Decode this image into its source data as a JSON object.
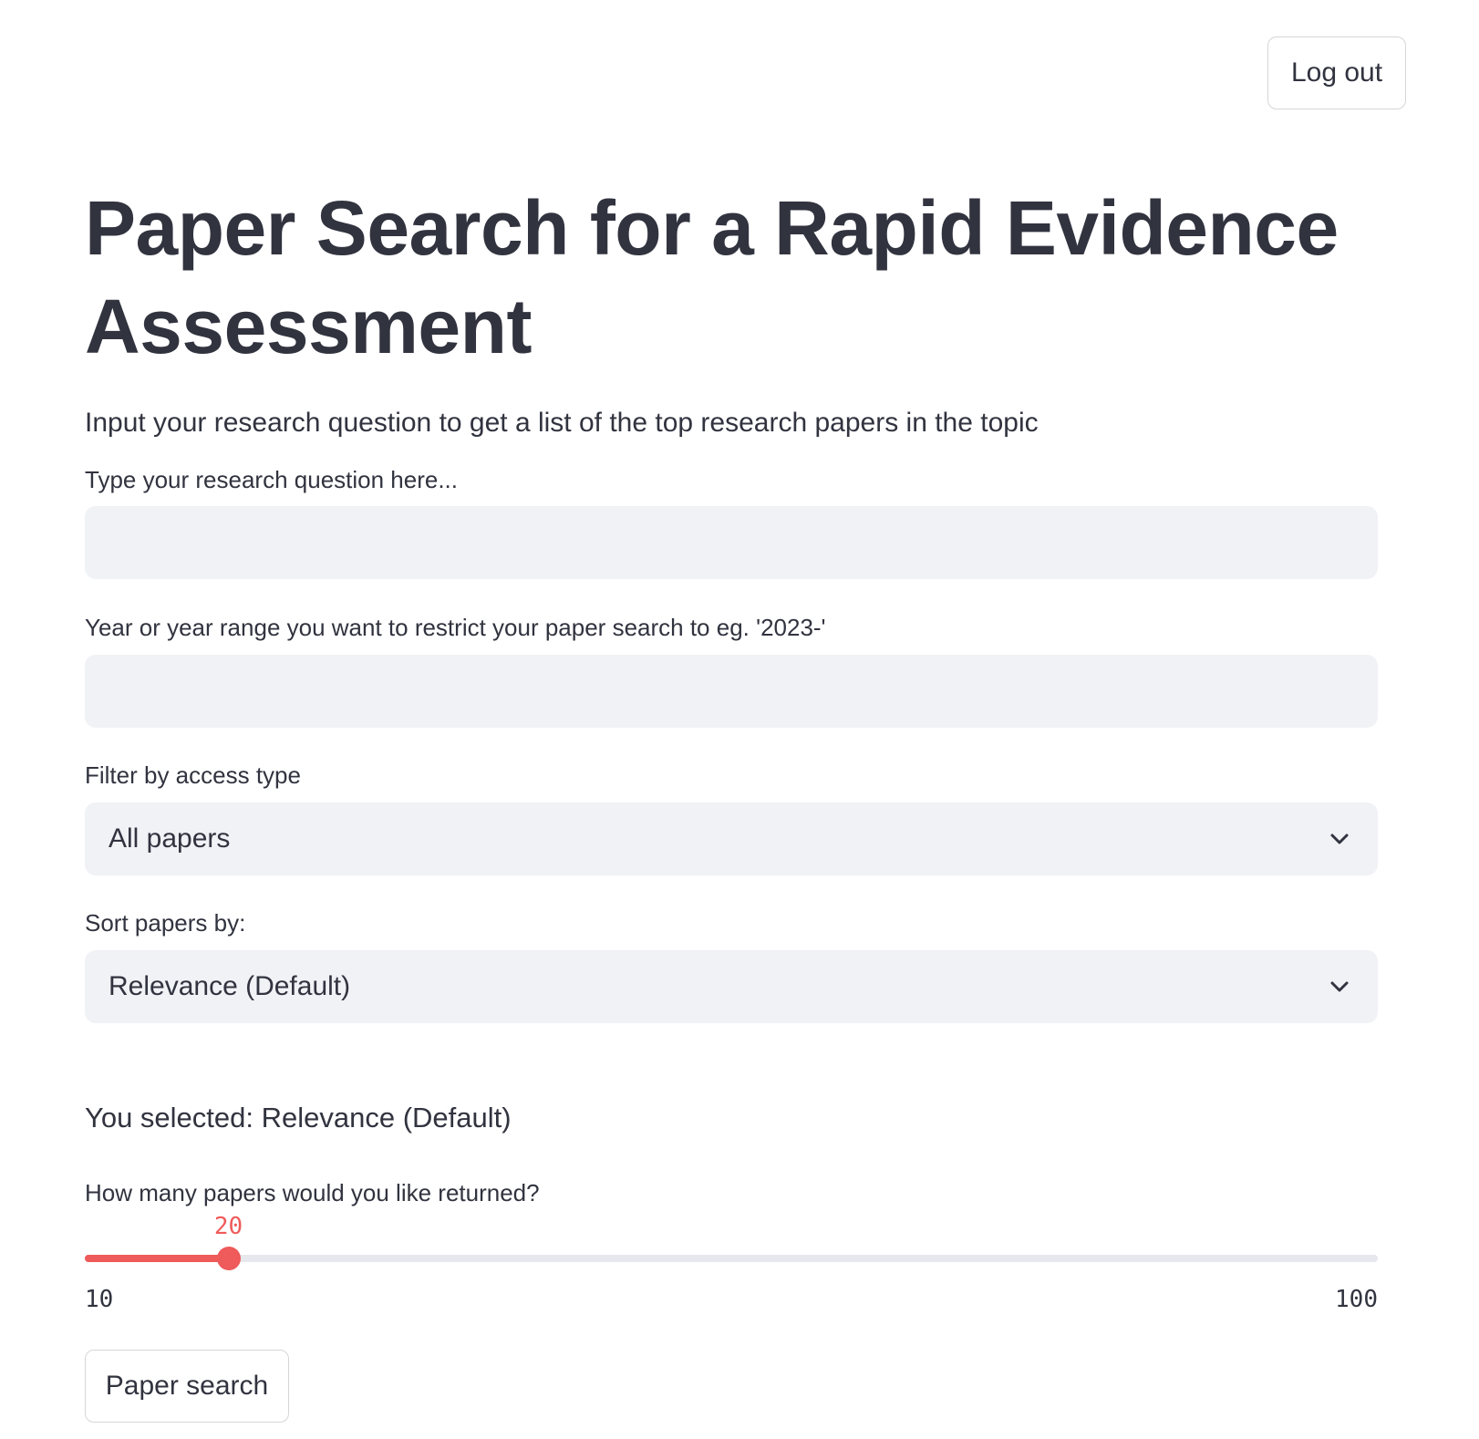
{
  "header": {
    "logout_label": "Log out"
  },
  "main": {
    "title": "Paper Search for a Rapid Evidence Assessment",
    "subtitle": "Input your research question to get a list of the top research papers in the topic"
  },
  "question_field": {
    "label": "Type your research question here...",
    "value": "",
    "placeholder": ""
  },
  "year_field": {
    "label": "Year or year range you want to restrict your paper search to eg. '2023-'",
    "value": "",
    "placeholder": ""
  },
  "access_filter": {
    "label": "Filter by access type",
    "selected": "All papers",
    "icon": "chevron-down-icon"
  },
  "sort_select": {
    "label": "Sort papers by:",
    "selected": "Relevance (Default)",
    "icon": "chevron-down-icon"
  },
  "selection_text": "You selected: Relevance (Default)",
  "papers_slider": {
    "label": "How many papers would you like returned?",
    "value": "20",
    "min": "10",
    "max": "100",
    "accent_color": "#ef5a5a",
    "track_color": "#e6e8ee"
  },
  "search_button_label": "Paper search",
  "colors": {
    "text": "#31333f",
    "input_bg": "#f0f2f6",
    "border": "#d6d6d9",
    "background": "#ffffff"
  }
}
